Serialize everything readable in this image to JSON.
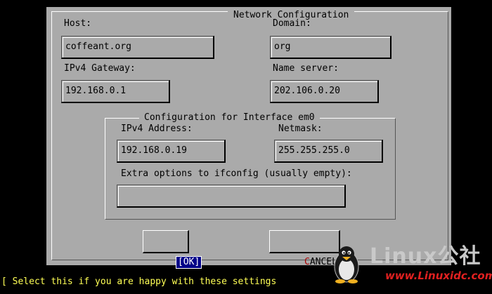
{
  "dialog": {
    "title": "Network Configuration",
    "host_label": "Host:",
    "host_value": "coffeant.org",
    "domain_label": "Domain:",
    "domain_value": "org",
    "gateway_label": "IPv4 Gateway:",
    "gateway_value": "192.168.0.1",
    "nameserver_label": "Name server:",
    "nameserver_value": "202.106.0.20"
  },
  "interface": {
    "title": "Configuration for Interface em0",
    "ipv4_label": "IPv4 Address:",
    "ipv4_value": "192.168.0.19",
    "netmask_label": "Netmask:",
    "netmask_value": "255.255.255.0",
    "extra_label": "Extra options to ifconfig (usually empty):",
    "extra_value": ""
  },
  "buttons": {
    "ok_bracket_open": "[",
    "ok_label": "OK",
    "ok_bracket_close": "]",
    "cancel_hotkey": "C",
    "cancel_rest": "ANCEL"
  },
  "status_text": "[ Select this if you are happy with these settings",
  "watermark": {
    "text": "Linux公社",
    "url": "www.Linuxidc.com"
  },
  "colors": {
    "background": "#000000",
    "dialog": "#aaaaaa",
    "status_text": "#ffff55",
    "ok_highlight": "#000088",
    "hotkey": "#aa0000"
  }
}
